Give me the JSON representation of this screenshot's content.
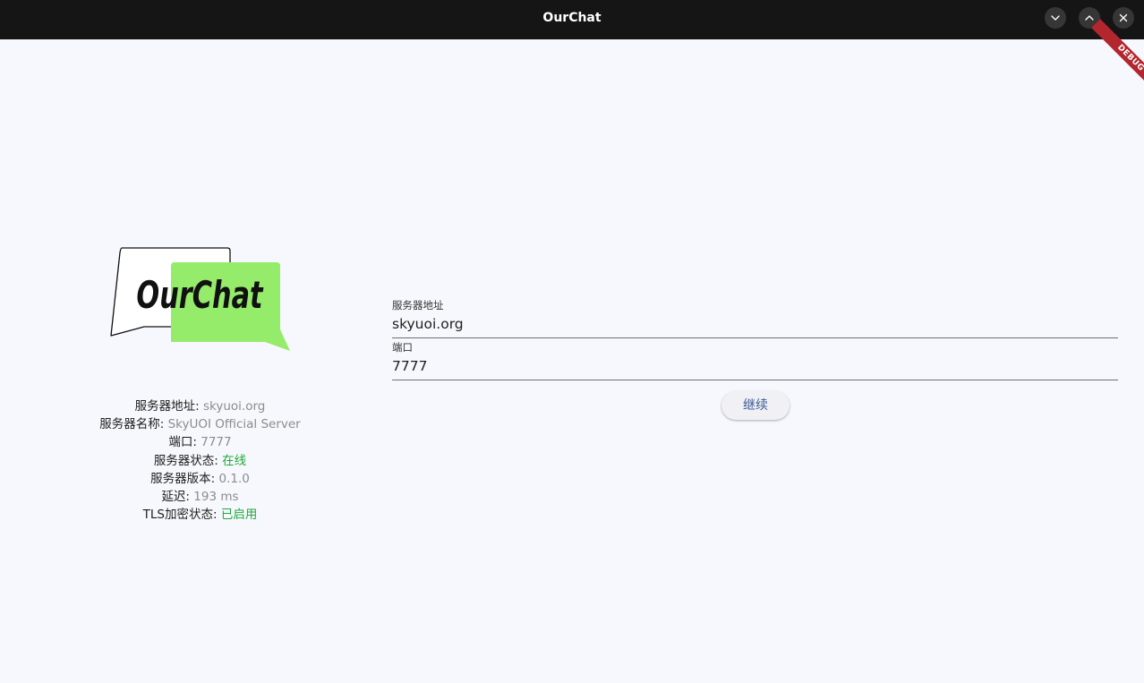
{
  "window": {
    "title": "OurChat",
    "debug_banner": "DEBUG"
  },
  "logo": {
    "text": "OurChat",
    "bubble_color": "#95ec6a"
  },
  "server_info": {
    "address_label": "服务器地址:",
    "address_value": "skyuoi.org",
    "name_label": "服务器名称:",
    "name_value": "SkyUOI Official Server",
    "port_label": "端口:",
    "port_value": "7777",
    "status_label": "服务器状态:",
    "status_value": "在线",
    "version_label": "服务器版本:",
    "version_value": "0.1.0",
    "latency_label": "延迟:",
    "latency_value": "193 ms",
    "tls_label": "TLS加密状态:",
    "tls_value": "已启用"
  },
  "form": {
    "address_label": "服务器地址",
    "address_value": "skyuoi.org",
    "port_label": "端口",
    "port_value": "7777",
    "continue_label": "继续"
  },
  "colors": {
    "background": "#f7f8fd",
    "titlebar": "#151515",
    "status_ok": "#1fa93a",
    "button_text": "#3b5b95",
    "debug_ribbon": "#b3262d"
  }
}
